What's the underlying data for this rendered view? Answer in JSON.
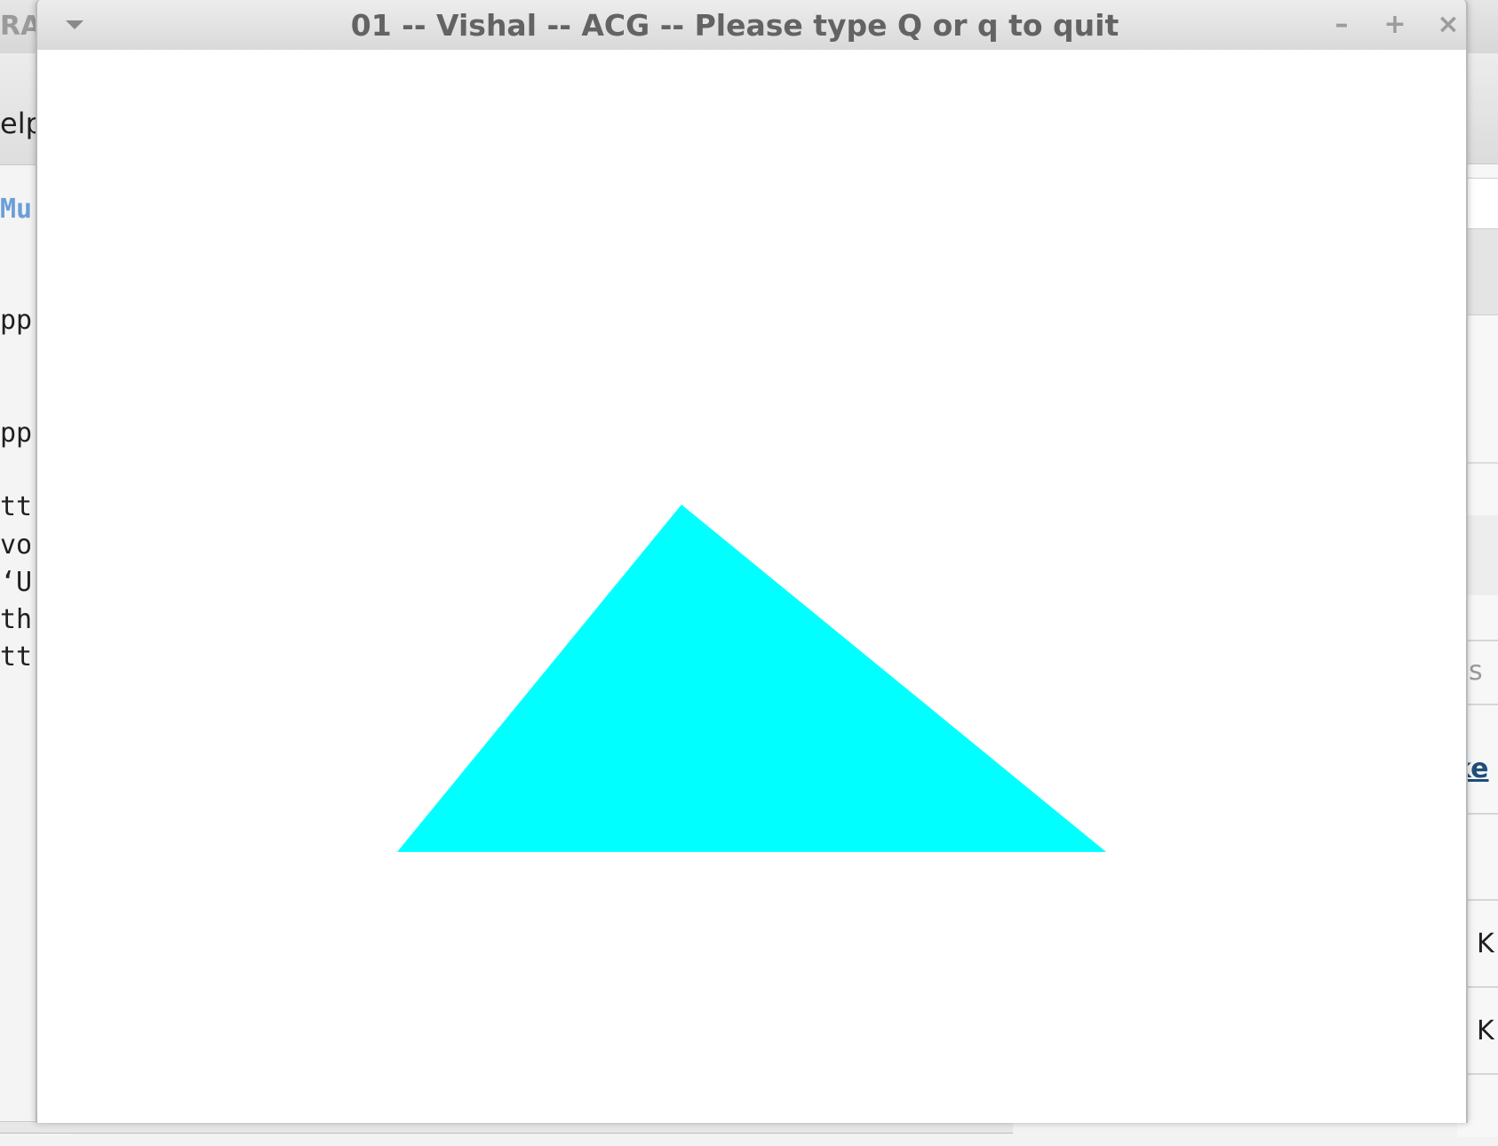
{
  "window": {
    "title": "01 -- Vishal -- ACG -- Please type Q or q to quit",
    "buttons": {
      "minimize": "–",
      "maximize": "+",
      "close": "×"
    }
  },
  "canvas": {
    "background": "#ffffff",
    "shape": "triangle",
    "fill_color": "#00ffff"
  },
  "background_left": {
    "fragments": [
      "RA",
      "elp",
      "Mu",
      "pp",
      "pp",
      "tt",
      "vo",
      "‘U",
      "th",
      "tt"
    ]
  },
  "background_right": {
    "fragments": [
      "ns",
      "ke",
      "K",
      "K"
    ]
  },
  "colors": {
    "titlebar": "#e0e0e0",
    "title_text": "#636363",
    "link_blue": "#6a9fd8"
  },
  "icons": {
    "window_menu": "chevron-down-icon",
    "minimize": "minimize-icon",
    "maximize": "maximize-icon",
    "close": "close-icon"
  }
}
